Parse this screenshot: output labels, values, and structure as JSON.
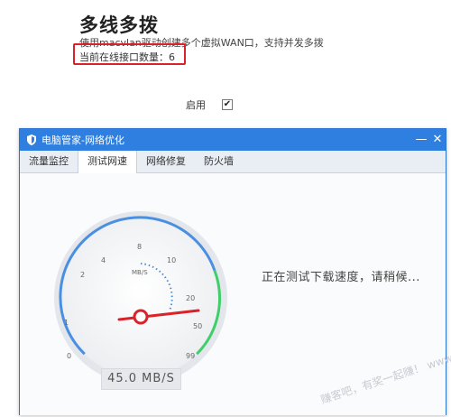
{
  "header": {
    "title": "多线多拨",
    "description": "使用macvlan驱动创建多个虚拟WAN口，支持并发多拨",
    "online_count_text": "当前在线接口数量：6"
  },
  "enable": {
    "label": "启用",
    "checked": true
  },
  "dialog": {
    "title": "电脑管家-网络优化",
    "minimize_symbol": "—",
    "close_symbol": "✕",
    "tabs": [
      {
        "label": "流量监控",
        "active": false
      },
      {
        "label": "测试网速",
        "active": true
      },
      {
        "label": "网络修复",
        "active": false
      },
      {
        "label": "防火墙",
        "active": false
      }
    ],
    "status_text": "正在测试下载速度，请稍候...",
    "gauge": {
      "unit_label": "MB/S",
      "scale_labels": [
        "0",
        "1",
        "2",
        "4",
        "8",
        "10",
        "20",
        "50",
        "99"
      ],
      "needle_value": "50",
      "readout": "45.0   MB/S"
    }
  },
  "watermark": "赚客吧，有奖一起赚！ www.zuanke8.com",
  "colors": {
    "titlebar": "#2e7fe0",
    "highlight": "#d9222a",
    "needle": "#d9222a",
    "gauge_arc_blue": "#4a8fe0",
    "gauge_arc_green": "#3fcf6a"
  }
}
